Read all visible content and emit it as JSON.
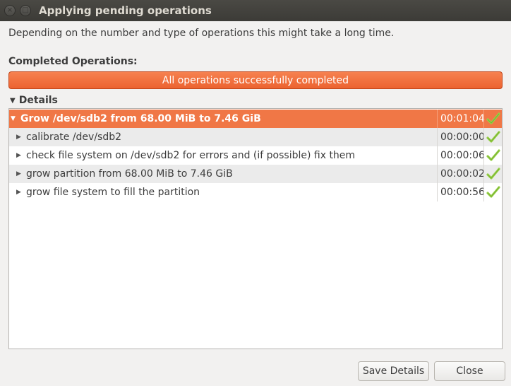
{
  "window": {
    "title": "Applying pending operations",
    "close_glyph": "×",
    "max_glyph": "□"
  },
  "description": "Depending on the number and type of operations this might take a long time.",
  "completed_label": "Completed Operations:",
  "progress": {
    "text": "All operations successfully completed",
    "fraction": 1.0
  },
  "details": {
    "header": "Details",
    "parent": {
      "label": "Grow /dev/sdb2 from 68.00 MiB to 7.46 GiB",
      "time": "00:01:04",
      "status_icon": "check-icon"
    },
    "children": [
      {
        "label": "calibrate /dev/sdb2",
        "time": "00:00:00",
        "status_icon": "check-icon"
      },
      {
        "label": "check file system on /dev/sdb2 for errors and (if possible) fix them",
        "time": "00:00:06",
        "status_icon": "check-icon"
      },
      {
        "label": "grow partition from 68.00 MiB to 7.46 GiB",
        "time": "00:00:02",
        "status_icon": "check-icon"
      },
      {
        "label": "grow file system to fill the partition",
        "time": "00:00:56",
        "status_icon": "check-icon"
      }
    ]
  },
  "buttons": {
    "save": "Save Details",
    "close": "Close"
  },
  "colors": {
    "accent": "#f07746",
    "check": "#7dbf2a",
    "titlebar": "#3c3b37"
  }
}
